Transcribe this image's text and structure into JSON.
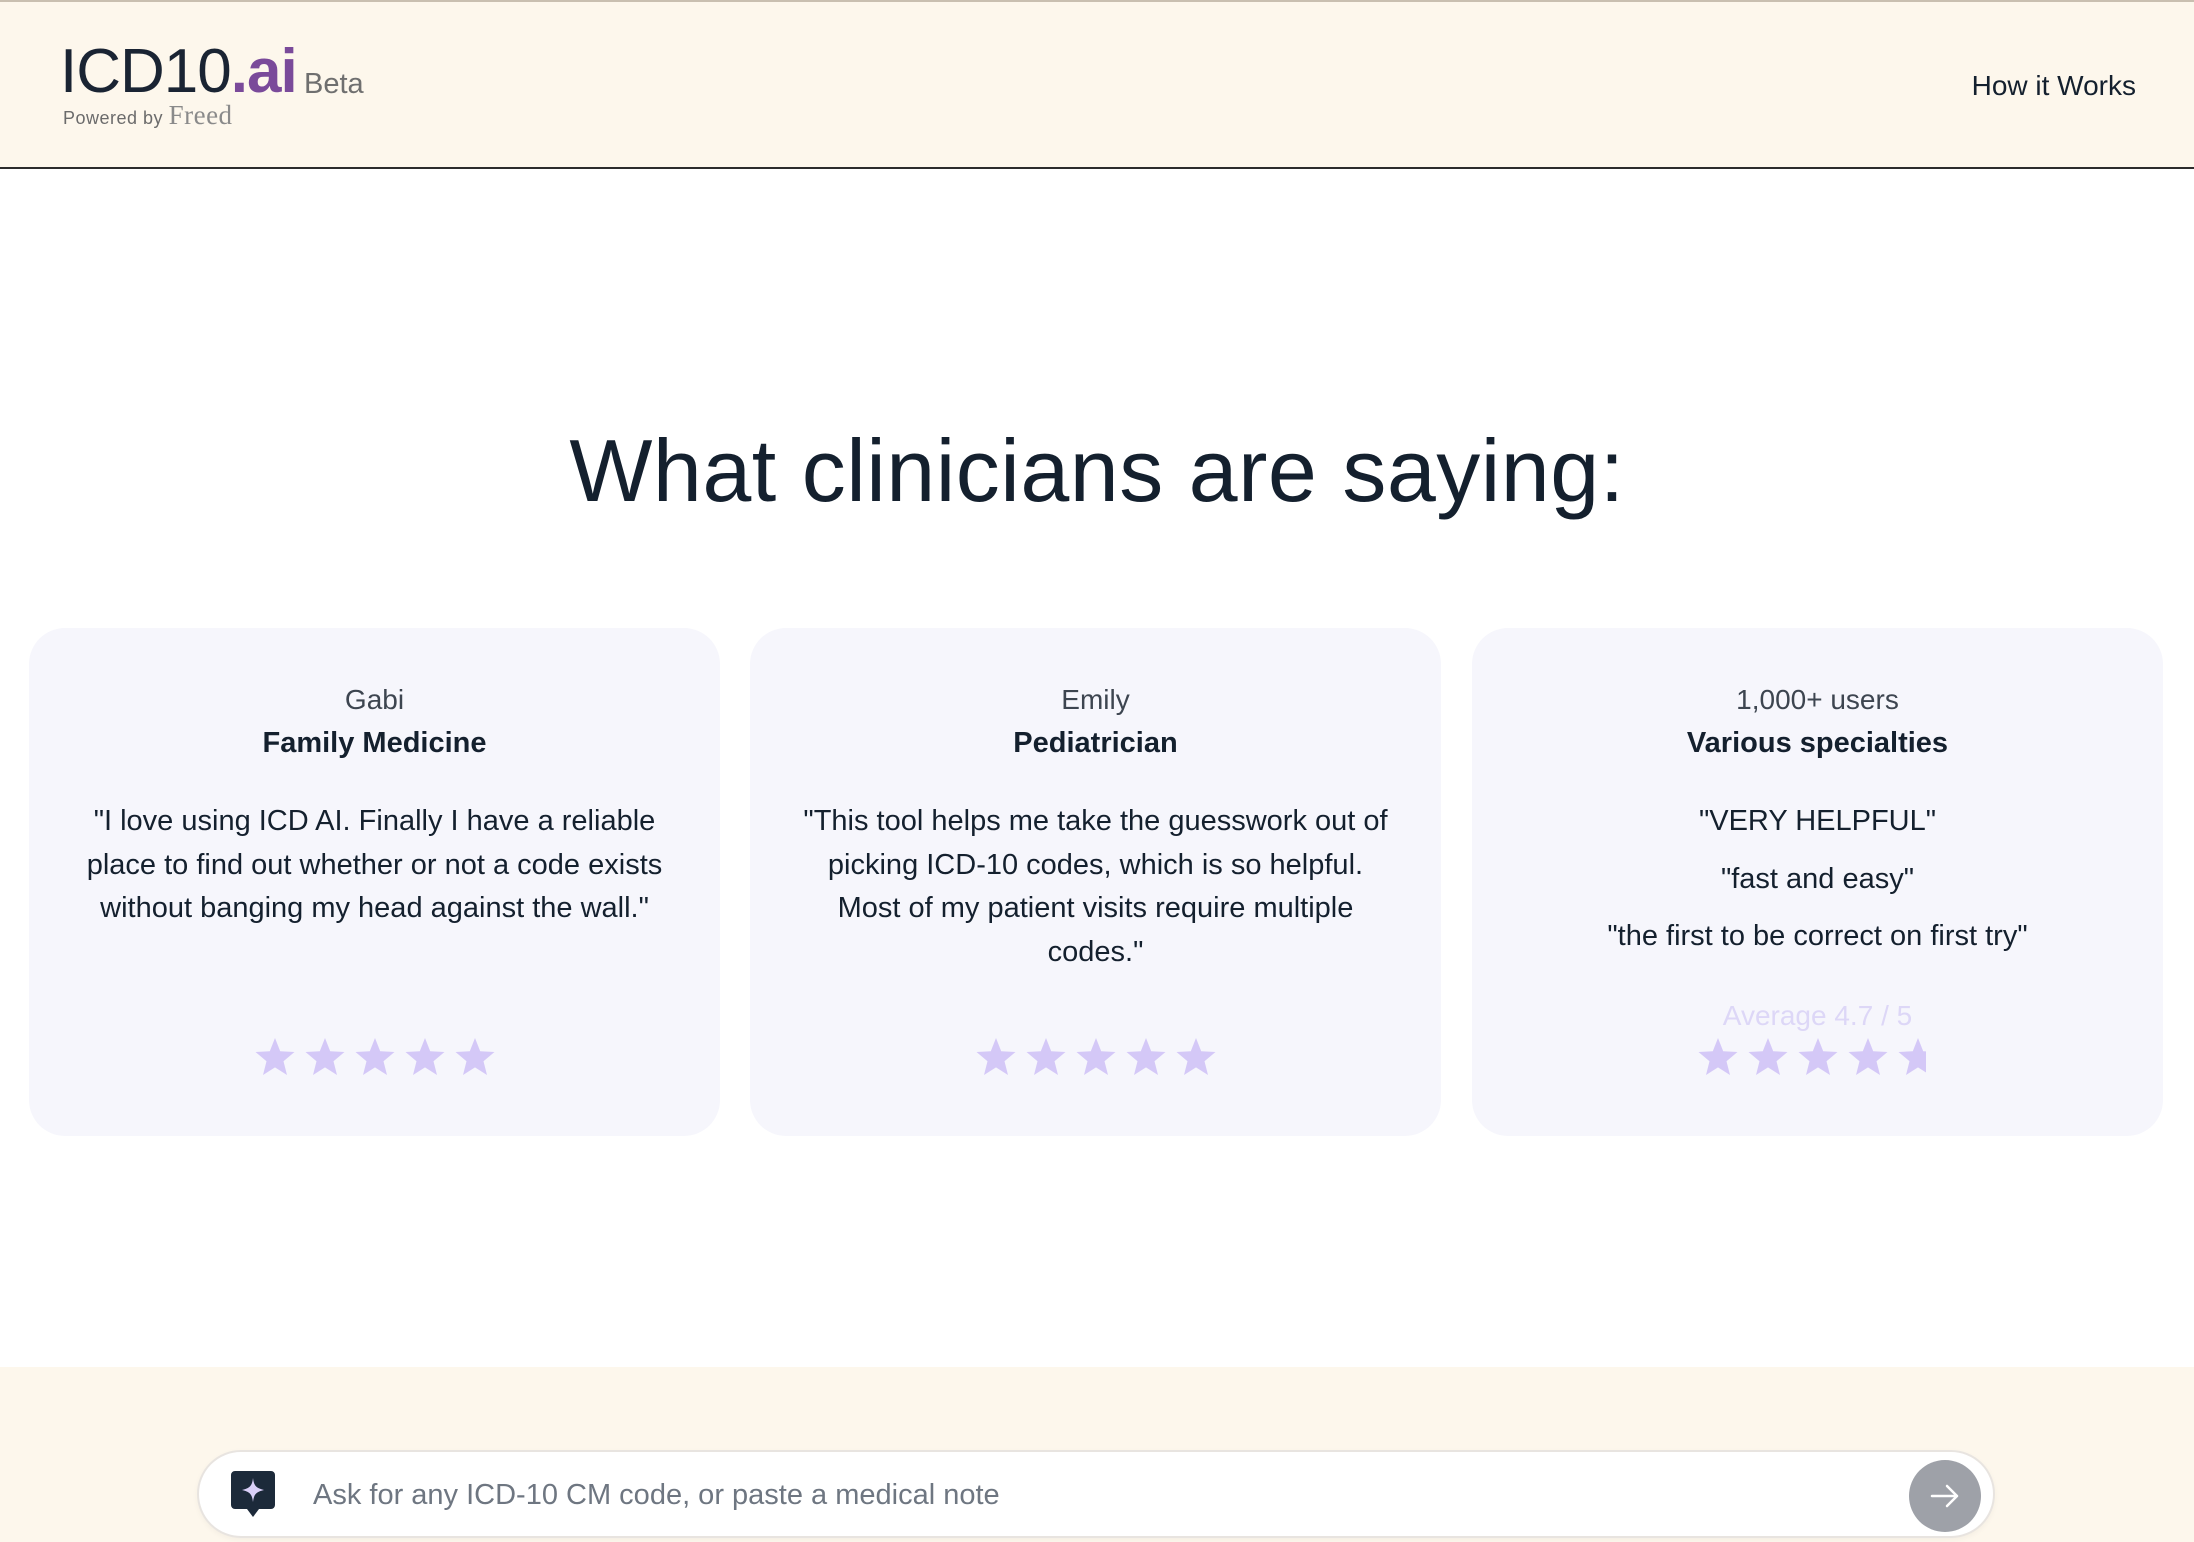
{
  "header": {
    "logo_main": "ICD10",
    "logo_ai": ".ai",
    "logo_beta": "Beta",
    "powered_by": "Powered by",
    "powered_brand": "Freed",
    "nav_how_it_works": "How it Works"
  },
  "headline": "What clinicians are saying:",
  "testimonials": [
    {
      "name": "Gabi",
      "role": "Family Medicine",
      "quote": "\"I love using ICD AI. Finally I have a reliable place to find out whether or not a code exists without banging my head against the wall.\"",
      "rating": 5
    },
    {
      "name": "Emily",
      "role": "Pediatrician",
      "quote": "\"This tool helps me take the guesswork out of picking ICD-10 codes, which is so helpful. Most of my patient visits require multiple codes.\"",
      "rating": 5
    },
    {
      "name": "1,000+ users",
      "role": "Various specialties",
      "quotes": [
        "\"VERY HELPFUL\"",
        "\"fast and easy\"",
        "\"the first to be correct on first try\""
      ],
      "average": "Average 4.7 / 5",
      "rating": 4.7
    }
  ],
  "chat": {
    "placeholder": "Ask for any ICD-10 CM code, or paste a medical note",
    "value": ""
  },
  "colors": {
    "header_bg": "#fdf7ec",
    "card_bg": "#f6f6fc",
    "star": "#d4c8f7",
    "text": "#14202e",
    "brand_purple": "#7a4a9a",
    "send_button": "#9ea1a8"
  }
}
